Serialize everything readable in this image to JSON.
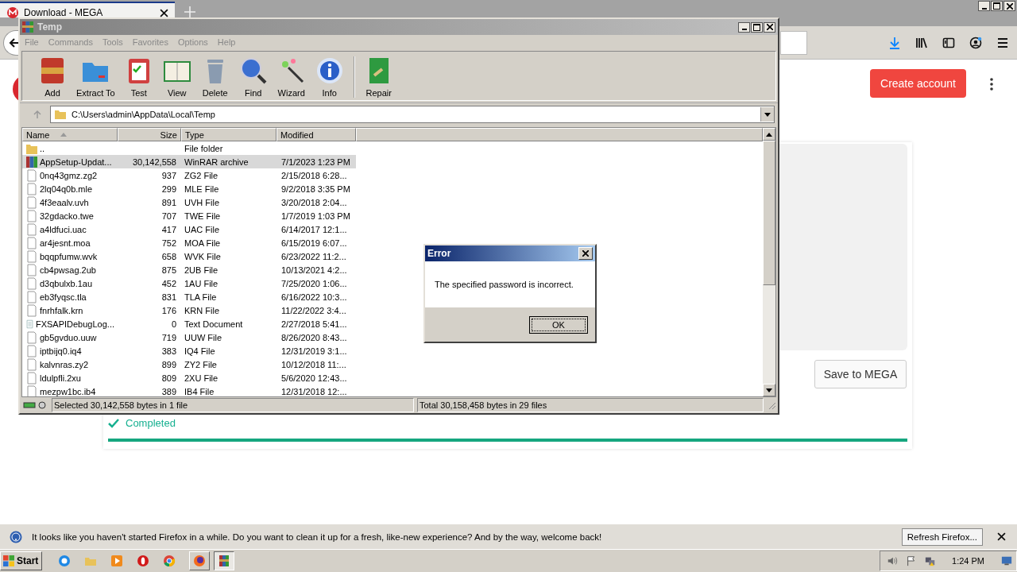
{
  "browser": {
    "tab_title": "Download - MEGA",
    "create_account": "Create account",
    "save_button": "Save to MEGA",
    "transfer_status": "Completed",
    "progress": {
      "level": 1
    },
    "notification": "It looks like you haven't started Firefox in a while. Do you want to clean it up for a fresh, like-new experience? And by the way, welcome back!",
    "refresh_button": "Refresh Firefox..."
  },
  "winrar": {
    "title": "Temp",
    "menu": [
      "File",
      "Commands",
      "Tools",
      "Favorites",
      "Options",
      "Help"
    ],
    "toolbar": [
      "Add",
      "Extract To",
      "Test",
      "View",
      "Delete",
      "Find",
      "Wizard",
      "Info",
      "Repair"
    ],
    "path": "C:\\Users\\admin\\AppData\\Local\\Temp",
    "columns": [
      "Name",
      "Size",
      "Type",
      "Modified"
    ],
    "rows": [
      {
        "kind": "folder",
        "name": "..",
        "size": "",
        "type": "File folder",
        "modified": "",
        "selected": false
      },
      {
        "kind": "archive",
        "name": "AppSetup-Updat...",
        "size": "30,142,558",
        "type": "WinRAR archive",
        "modified": "7/1/2023 1:23 PM",
        "selected": true
      },
      {
        "kind": "file",
        "name": "0nq43gmz.zg2",
        "size": "937",
        "type": "ZG2 File",
        "modified": "2/15/2018 6:28...",
        "selected": false
      },
      {
        "kind": "file",
        "name": "2lq04q0b.mle",
        "size": "299",
        "type": "MLE File",
        "modified": "9/2/2018 3:35 PM",
        "selected": false
      },
      {
        "kind": "file",
        "name": "4f3eaalv.uvh",
        "size": "891",
        "type": "UVH File",
        "modified": "3/20/2018 2:04...",
        "selected": false
      },
      {
        "kind": "file",
        "name": "32gdacko.twe",
        "size": "707",
        "type": "TWE File",
        "modified": "1/7/2019 1:03 PM",
        "selected": false
      },
      {
        "kind": "file",
        "name": "a4ldfuci.uac",
        "size": "417",
        "type": "UAC File",
        "modified": "6/14/2017 12:1...",
        "selected": false
      },
      {
        "kind": "file",
        "name": "ar4jesnt.moa",
        "size": "752",
        "type": "MOA File",
        "modified": "6/15/2019 6:07...",
        "selected": false
      },
      {
        "kind": "file",
        "name": "bqqpfumw.wvk",
        "size": "658",
        "type": "WVK File",
        "modified": "6/23/2022 11:2...",
        "selected": false
      },
      {
        "kind": "file",
        "name": "cb4pwsag.2ub",
        "size": "875",
        "type": "2UB File",
        "modified": "10/13/2021 4:2...",
        "selected": false
      },
      {
        "kind": "file",
        "name": "d3qbulxb.1au",
        "size": "452",
        "type": "1AU File",
        "modified": "7/25/2020 1:06...",
        "selected": false
      },
      {
        "kind": "file",
        "name": "eb3fyqsc.tla",
        "size": "831",
        "type": "TLA File",
        "modified": "6/16/2022 10:3...",
        "selected": false
      },
      {
        "kind": "file",
        "name": "fnrhfalk.krn",
        "size": "176",
        "type": "KRN File",
        "modified": "11/22/2022 3:4...",
        "selected": false
      },
      {
        "kind": "text",
        "name": "FXSAPIDebugLog...",
        "size": "0",
        "type": "Text Document",
        "modified": "2/27/2018 5:41...",
        "selected": false
      },
      {
        "kind": "file",
        "name": "gb5gvduo.uuw",
        "size": "719",
        "type": "UUW File",
        "modified": "8/26/2020 8:43...",
        "selected": false
      },
      {
        "kind": "file",
        "name": "iptbijq0.iq4",
        "size": "383",
        "type": "IQ4 File",
        "modified": "12/31/2019 3:1...",
        "selected": false
      },
      {
        "kind": "file",
        "name": "kalvnras.zy2",
        "size": "899",
        "type": "ZY2 File",
        "modified": "10/12/2018 11:...",
        "selected": false
      },
      {
        "kind": "file",
        "name": "ldulpfli.2xu",
        "size": "809",
        "type": "2XU File",
        "modified": "5/6/2020 12:43...",
        "selected": false
      },
      {
        "kind": "file",
        "name": "mezpw1bc.ib4",
        "size": "389",
        "type": "IB4 File",
        "modified": "12/31/2018 12:...",
        "selected": false
      }
    ],
    "status_left": "Selected 30,142,558 bytes in 1 file",
    "status_right": "Total 30,158,458 bytes in 29 files"
  },
  "dialog": {
    "title": "Error",
    "message": "The specified password is incorrect.",
    "button": "OK"
  },
  "taskbar": {
    "start": "Start",
    "clock": "1:24 PM"
  }
}
